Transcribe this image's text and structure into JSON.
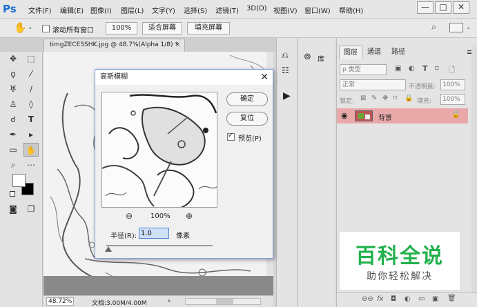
{
  "app": {
    "logo": "Ps",
    "menus": [
      "文件(F)",
      "编辑(E)",
      "图像(I)",
      "图层(L)",
      "文字(Y)",
      "选择(S)",
      "滤镜(T)",
      "3D(D)",
      "视图(V)",
      "窗口(W)",
      "帮助(H)"
    ],
    "window_buttons": [
      "—",
      "□",
      "✕"
    ]
  },
  "options_bar": {
    "scroll_all_label": "滚动所有窗口",
    "zoom_100": "100%",
    "fit_screen": "适合屏幕",
    "fill_screen": "填充屏幕"
  },
  "document": {
    "tab_title": "timgZECE5SHK.jpg @ 48.7%(Alpha 1/8) *",
    "tab_close": "×",
    "zoom_status": "48.72%",
    "doc_info": "文档:3.00M/4.00M"
  },
  "library": {
    "label": "库"
  },
  "layers_panel": {
    "tabs": [
      "图层",
      "通道",
      "路径"
    ],
    "active_tab": "图层",
    "filter_kind": "ρ 类型",
    "blend_mode": "正常",
    "opacity_label": "不透明度:",
    "opacity_value": "100%",
    "lock_label": "锁定:",
    "fill_label": "填充:",
    "fill_value": "100%",
    "layer_name": "背景",
    "layer_highlight_color": "#e9a9a9",
    "bottom_icons": [
      "⊖⊖",
      "fx",
      "◘",
      "◐",
      "▭",
      "▣",
      "🗑"
    ]
  },
  "dialog": {
    "title": "高斯模糊",
    "ok_label": "确定",
    "reset_label": "复位",
    "preview_label": "预览(P)",
    "preview_checked": true,
    "zoom_level": "100%",
    "radius_label": "半径(R):",
    "radius_value": "1.0",
    "unit_label": "像素",
    "radius_slider_fraction": 0.02
  },
  "watermark": {
    "big": "百科全说",
    "small": "助你轻松解决",
    "color": "#22b14c"
  }
}
